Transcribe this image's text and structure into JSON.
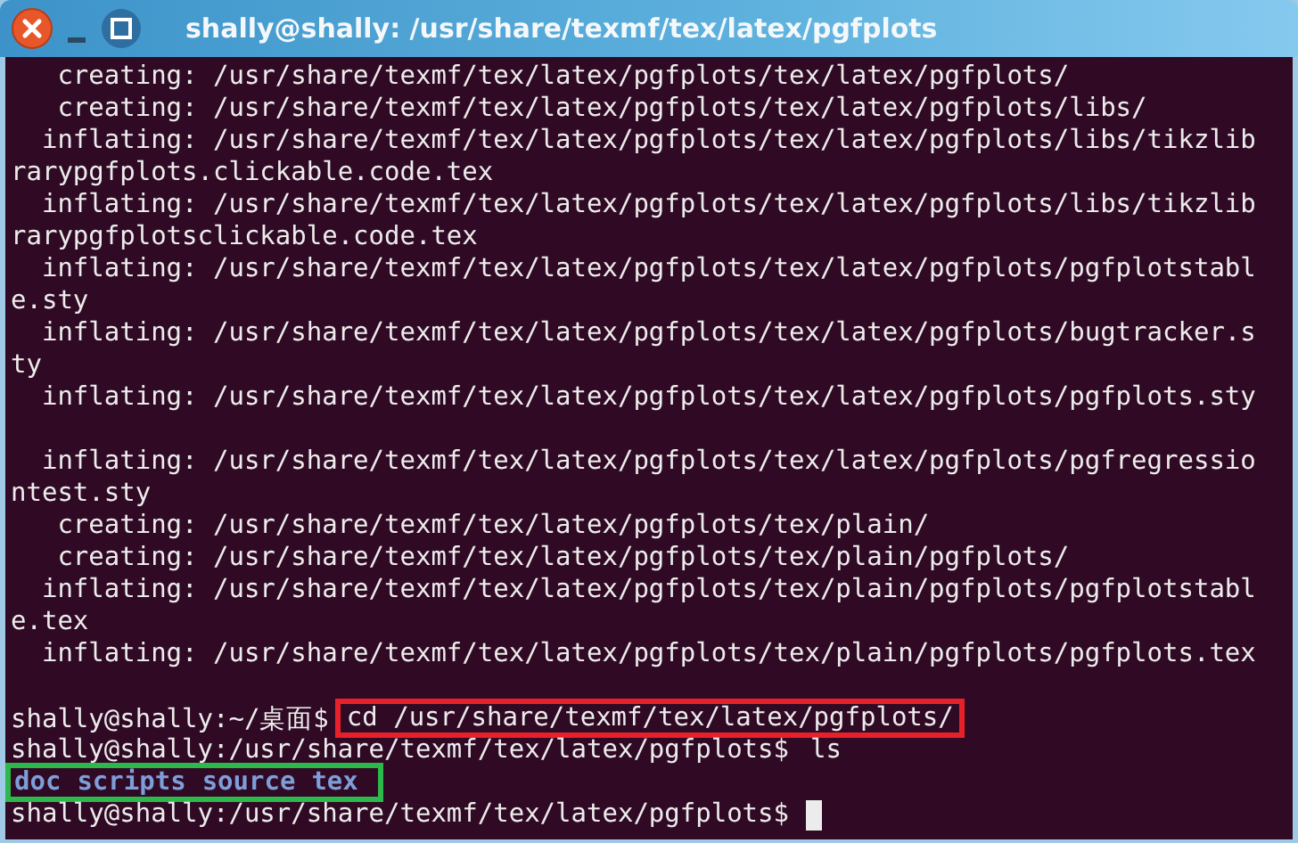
{
  "window": {
    "title": "shally@shally: /usr/share/texmf/tex/latex/pgfplots"
  },
  "terminal": {
    "lines": [
      {
        "kind": "output",
        "text": "   creating: /usr/share/texmf/tex/latex/pgfplots/tex/latex/pgfplots/"
      },
      {
        "kind": "output",
        "text": "   creating: /usr/share/texmf/tex/latex/pgfplots/tex/latex/pgfplots/libs/"
      },
      {
        "kind": "output",
        "text": "  inflating: /usr/share/texmf/tex/latex/pgfplots/tex/latex/pgfplots/libs/tikzlib"
      },
      {
        "kind": "output",
        "text": "rarypgfplots.clickable.code.tex"
      },
      {
        "kind": "output",
        "text": "  inflating: /usr/share/texmf/tex/latex/pgfplots/tex/latex/pgfplots/libs/tikzlib"
      },
      {
        "kind": "output",
        "text": "rarypgfplotsclickable.code.tex"
      },
      {
        "kind": "output",
        "text": "  inflating: /usr/share/texmf/tex/latex/pgfplots/tex/latex/pgfplots/pgfplotstabl"
      },
      {
        "kind": "output",
        "text": "e.sty"
      },
      {
        "kind": "output",
        "text": "  inflating: /usr/share/texmf/tex/latex/pgfplots/tex/latex/pgfplots/bugtracker.s"
      },
      {
        "kind": "output",
        "text": "ty"
      },
      {
        "kind": "output",
        "text": "  inflating: /usr/share/texmf/tex/latex/pgfplots/tex/latex/pgfplots/pgfplots.sty"
      },
      {
        "kind": "blank"
      },
      {
        "kind": "output",
        "text": "  inflating: /usr/share/texmf/tex/latex/pgfplots/tex/latex/pgfplots/pgfregressio"
      },
      {
        "kind": "output",
        "text": "ntest.sty"
      },
      {
        "kind": "output",
        "text": "   creating: /usr/share/texmf/tex/latex/pgfplots/tex/plain/"
      },
      {
        "kind": "output",
        "text": "   creating: /usr/share/texmf/tex/latex/pgfplots/tex/plain/pgfplots/"
      },
      {
        "kind": "output",
        "text": "  inflating: /usr/share/texmf/tex/latex/pgfplots/tex/plain/pgfplots/pgfplotstabl"
      },
      {
        "kind": "output",
        "text": "e.tex"
      },
      {
        "kind": "output",
        "text": "  inflating: /usr/share/texmf/tex/latex/pgfplots/tex/plain/pgfplots/pgfplots.tex"
      },
      {
        "kind": "blank"
      },
      {
        "kind": "prompt",
        "prompt": "shally@shally:~/桌面$",
        "command": "cd /usr/share/texmf/tex/latex/pgfplots/",
        "color": "#e8202a"
      },
      {
        "kind": "prompt",
        "prompt": "shally@shally:/usr/share/texmf/tex/latex/pgfplots$",
        "command": "ls"
      },
      {
        "kind": "dirs",
        "items": [
          "doc",
          "scripts",
          "source",
          "tex"
        ],
        "color": "#2cb84a"
      },
      {
        "kind": "prompt",
        "prompt": "shally@shally:/usr/share/texmf/tex/latex/pgfplots$",
        "cursor": true
      }
    ]
  }
}
